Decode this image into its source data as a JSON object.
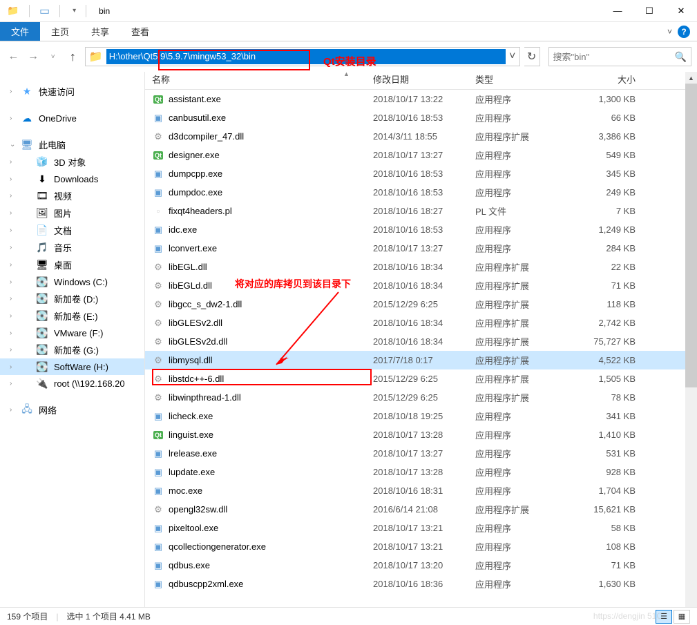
{
  "title": "bin",
  "ribbon": {
    "file": "文件",
    "home": "主页",
    "share": "共享",
    "view": "查看"
  },
  "address": "H:\\other\\Qt5.9\\5.9.7\\mingw53_32\\bin",
  "search_placeholder": "搜索\"bin\"",
  "annot1": "Qt安装目录",
  "annot2": "将对应的库拷贝到该目录下",
  "columns": {
    "name": "名称",
    "date": "修改日期",
    "type": "类型",
    "size": "大小"
  },
  "sidebar": {
    "quick": "快速访问",
    "onedrive": "OneDrive",
    "thispc": "此电脑",
    "items": [
      {
        "label": "3D 对象",
        "ic": "3d"
      },
      {
        "label": "Downloads",
        "ic": "dl"
      },
      {
        "label": "视频",
        "ic": "vid"
      },
      {
        "label": "图片",
        "ic": "pic"
      },
      {
        "label": "文档",
        "ic": "doc"
      },
      {
        "label": "音乐",
        "ic": "mus"
      },
      {
        "label": "桌面",
        "ic": "desk"
      },
      {
        "label": "Windows (C:)",
        "ic": "drive"
      },
      {
        "label": "新加卷 (D:)",
        "ic": "drive"
      },
      {
        "label": "新加卷 (E:)",
        "ic": "drive"
      },
      {
        "label": "VMware (F:)",
        "ic": "drive"
      },
      {
        "label": "新加卷 (G:)",
        "ic": "drive"
      },
      {
        "label": "SoftWare (H:)",
        "ic": "drive",
        "sel": true
      },
      {
        "label": "root (\\\\192.168.20",
        "ic": "net"
      }
    ],
    "network": "网络"
  },
  "files": [
    {
      "name": "assistant.exe",
      "date": "2018/10/17 13:22",
      "type": "应用程序",
      "size": "1,300 KB",
      "ic": "qt"
    },
    {
      "name": "canbusutil.exe",
      "date": "2018/10/16 18:53",
      "type": "应用程序",
      "size": "66 KB",
      "ic": "exe"
    },
    {
      "name": "d3dcompiler_47.dll",
      "date": "2014/3/11 18:55",
      "type": "应用程序扩展",
      "size": "3,386 KB",
      "ic": "dll"
    },
    {
      "name": "designer.exe",
      "date": "2018/10/17 13:27",
      "type": "应用程序",
      "size": "549 KB",
      "ic": "qt"
    },
    {
      "name": "dumpcpp.exe",
      "date": "2018/10/16 18:53",
      "type": "应用程序",
      "size": "345 KB",
      "ic": "exe"
    },
    {
      "name": "dumpdoc.exe",
      "date": "2018/10/16 18:53",
      "type": "应用程序",
      "size": "249 KB",
      "ic": "exe"
    },
    {
      "name": "fixqt4headers.pl",
      "date": "2018/10/16 18:27",
      "type": "PL 文件",
      "size": "7 KB",
      "ic": "file"
    },
    {
      "name": "idc.exe",
      "date": "2018/10/16 18:53",
      "type": "应用程序",
      "size": "1,249 KB",
      "ic": "exe"
    },
    {
      "name": "lconvert.exe",
      "date": "2018/10/17 13:27",
      "type": "应用程序",
      "size": "284 KB",
      "ic": "exe"
    },
    {
      "name": "libEGL.dll",
      "date": "2018/10/16 18:34",
      "type": "应用程序扩展",
      "size": "22 KB",
      "ic": "dll"
    },
    {
      "name": "libEGLd.dll",
      "date": "2018/10/16 18:34",
      "type": "应用程序扩展",
      "size": "71 KB",
      "ic": "dll"
    },
    {
      "name": "libgcc_s_dw2-1.dll",
      "date": "2015/12/29 6:25",
      "type": "应用程序扩展",
      "size": "118 KB",
      "ic": "dll"
    },
    {
      "name": "libGLESv2.dll",
      "date": "2018/10/16 18:34",
      "type": "应用程序扩展",
      "size": "2,742 KB",
      "ic": "dll"
    },
    {
      "name": "libGLESv2d.dll",
      "date": "2018/10/16 18:34",
      "type": "应用程序扩展",
      "size": "75,727 KB",
      "ic": "dll"
    },
    {
      "name": "libmysql.dll",
      "date": "2017/7/18 0:17",
      "type": "应用程序扩展",
      "size": "4,522 KB",
      "ic": "dll",
      "sel": true
    },
    {
      "name": "libstdc++-6.dll",
      "date": "2015/12/29 6:25",
      "type": "应用程序扩展",
      "size": "1,505 KB",
      "ic": "dll"
    },
    {
      "name": "libwinpthread-1.dll",
      "date": "2015/12/29 6:25",
      "type": "应用程序扩展",
      "size": "78 KB",
      "ic": "dll"
    },
    {
      "name": "licheck.exe",
      "date": "2018/10/18 19:25",
      "type": "应用程序",
      "size": "341 KB",
      "ic": "exe"
    },
    {
      "name": "linguist.exe",
      "date": "2018/10/17 13:28",
      "type": "应用程序",
      "size": "1,410 KB",
      "ic": "qt"
    },
    {
      "name": "lrelease.exe",
      "date": "2018/10/17 13:27",
      "type": "应用程序",
      "size": "531 KB",
      "ic": "exe"
    },
    {
      "name": "lupdate.exe",
      "date": "2018/10/17 13:28",
      "type": "应用程序",
      "size": "928 KB",
      "ic": "exe"
    },
    {
      "name": "moc.exe",
      "date": "2018/10/16 18:31",
      "type": "应用程序",
      "size": "1,704 KB",
      "ic": "exe"
    },
    {
      "name": "opengl32sw.dll",
      "date": "2016/6/14 21:08",
      "type": "应用程序扩展",
      "size": "15,621 KB",
      "ic": "dll"
    },
    {
      "name": "pixeltool.exe",
      "date": "2018/10/17 13:21",
      "type": "应用程序",
      "size": "58 KB",
      "ic": "exe"
    },
    {
      "name": "qcollectiongenerator.exe",
      "date": "2018/10/17 13:21",
      "type": "应用程序",
      "size": "108 KB",
      "ic": "exe"
    },
    {
      "name": "qdbus.exe",
      "date": "2018/10/17 13:20",
      "type": "应用程序",
      "size": "71 KB",
      "ic": "exe"
    },
    {
      "name": "qdbuscpp2xml.exe",
      "date": "2018/10/16 18:36",
      "type": "应用程序",
      "size": "1,630 KB",
      "ic": "exe"
    }
  ],
  "status": {
    "count": "159 个项目",
    "sel": "选中 1 个项目 4.41 MB"
  },
  "watermark": "https://dengjin 51C"
}
